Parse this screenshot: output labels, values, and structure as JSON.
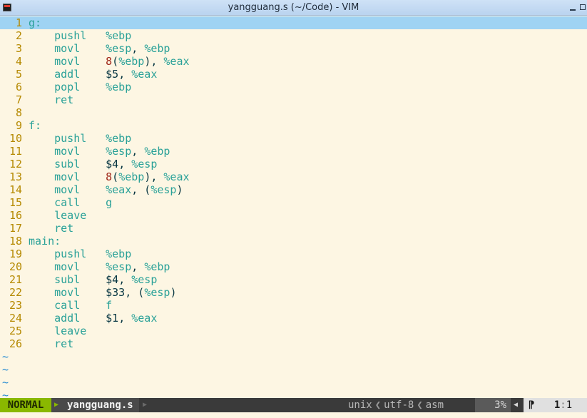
{
  "window": {
    "title": "yangguang.s (~/Code) - VIM"
  },
  "editor": {
    "lines": [
      {
        "n": "1",
        "label": "g:"
      },
      {
        "n": "2",
        "op": "pushl",
        "args": [
          [
            "reg",
            "%ebp"
          ]
        ]
      },
      {
        "n": "3",
        "op": "movl",
        "args": [
          [
            "reg",
            "%esp"
          ],
          [
            "punct",
            ", "
          ],
          [
            "reg",
            "%ebp"
          ]
        ]
      },
      {
        "n": "4",
        "op": "movl",
        "args": [
          [
            "num",
            "8"
          ],
          [
            "punct",
            "("
          ],
          [
            "reg",
            "%ebp"
          ],
          [
            "punct",
            "), "
          ],
          [
            "reg",
            "%eax"
          ]
        ]
      },
      {
        "n": "5",
        "op": "addl",
        "args": [
          [
            "imm",
            "$5"
          ],
          [
            "punct",
            ", "
          ],
          [
            "reg",
            "%eax"
          ]
        ]
      },
      {
        "n": "6",
        "op": "popl",
        "args": [
          [
            "reg",
            "%ebp"
          ]
        ]
      },
      {
        "n": "7",
        "op": "ret",
        "args": []
      },
      {
        "n": "8"
      },
      {
        "n": "9",
        "label": "f:"
      },
      {
        "n": "10",
        "op": "pushl",
        "args": [
          [
            "reg",
            "%ebp"
          ]
        ]
      },
      {
        "n": "11",
        "op": "movl",
        "args": [
          [
            "reg",
            "%esp"
          ],
          [
            "punct",
            ", "
          ],
          [
            "reg",
            "%ebp"
          ]
        ]
      },
      {
        "n": "12",
        "op": "subl",
        "args": [
          [
            "imm",
            "$4"
          ],
          [
            "punct",
            ", "
          ],
          [
            "reg",
            "%esp"
          ]
        ]
      },
      {
        "n": "13",
        "op": "movl",
        "args": [
          [
            "num",
            "8"
          ],
          [
            "punct",
            "("
          ],
          [
            "reg",
            "%ebp"
          ],
          [
            "punct",
            "), "
          ],
          [
            "reg",
            "%eax"
          ]
        ]
      },
      {
        "n": "14",
        "op": "movl",
        "args": [
          [
            "reg",
            "%eax"
          ],
          [
            "punct",
            ", ("
          ],
          [
            "reg",
            "%esp"
          ],
          [
            "punct",
            ")"
          ]
        ]
      },
      {
        "n": "15",
        "op": "call",
        "args": [
          [
            "reg",
            "g"
          ]
        ]
      },
      {
        "n": "16",
        "op": "leave",
        "args": []
      },
      {
        "n": "17",
        "op": "ret",
        "args": []
      },
      {
        "n": "18",
        "label": "main:"
      },
      {
        "n": "19",
        "op": "pushl",
        "args": [
          [
            "reg",
            "%ebp"
          ]
        ]
      },
      {
        "n": "20",
        "op": "movl",
        "args": [
          [
            "reg",
            "%esp"
          ],
          [
            "punct",
            ", "
          ],
          [
            "reg",
            "%ebp"
          ]
        ]
      },
      {
        "n": "21",
        "op": "subl",
        "args": [
          [
            "imm",
            "$4"
          ],
          [
            "punct",
            ", "
          ],
          [
            "reg",
            "%esp"
          ]
        ]
      },
      {
        "n": "22",
        "op": "movl",
        "args": [
          [
            "imm",
            "$33"
          ],
          [
            "punct",
            ", ("
          ],
          [
            "reg",
            "%esp"
          ],
          [
            "punct",
            ")"
          ]
        ]
      },
      {
        "n": "23",
        "op": "call",
        "args": [
          [
            "reg",
            "f"
          ]
        ]
      },
      {
        "n": "24",
        "op": "addl",
        "args": [
          [
            "imm",
            "$1"
          ],
          [
            "punct",
            ", "
          ],
          [
            "reg",
            "%eax"
          ]
        ]
      },
      {
        "n": "25",
        "op": "leave",
        "args": []
      },
      {
        "n": "26",
        "op": "ret",
        "args": []
      }
    ],
    "cursor_line": 1,
    "filler": [
      "~",
      "~",
      "~",
      "~"
    ]
  },
  "statusline": {
    "mode": "NORMAL",
    "filename": "yangguang.s",
    "fileformat": "unix",
    "encoding": "utf-8",
    "filetype": "asm",
    "percent": "3%",
    "line_icon": "⁋",
    "line": "1",
    "column": "1"
  },
  "colors": {
    "background": "#fdf6e3",
    "line_number": "#b58900",
    "keyword": "#2aa198",
    "number": "#a0281a",
    "cursorline": "#9fd3f3",
    "mode_normal": "#8ab800"
  }
}
